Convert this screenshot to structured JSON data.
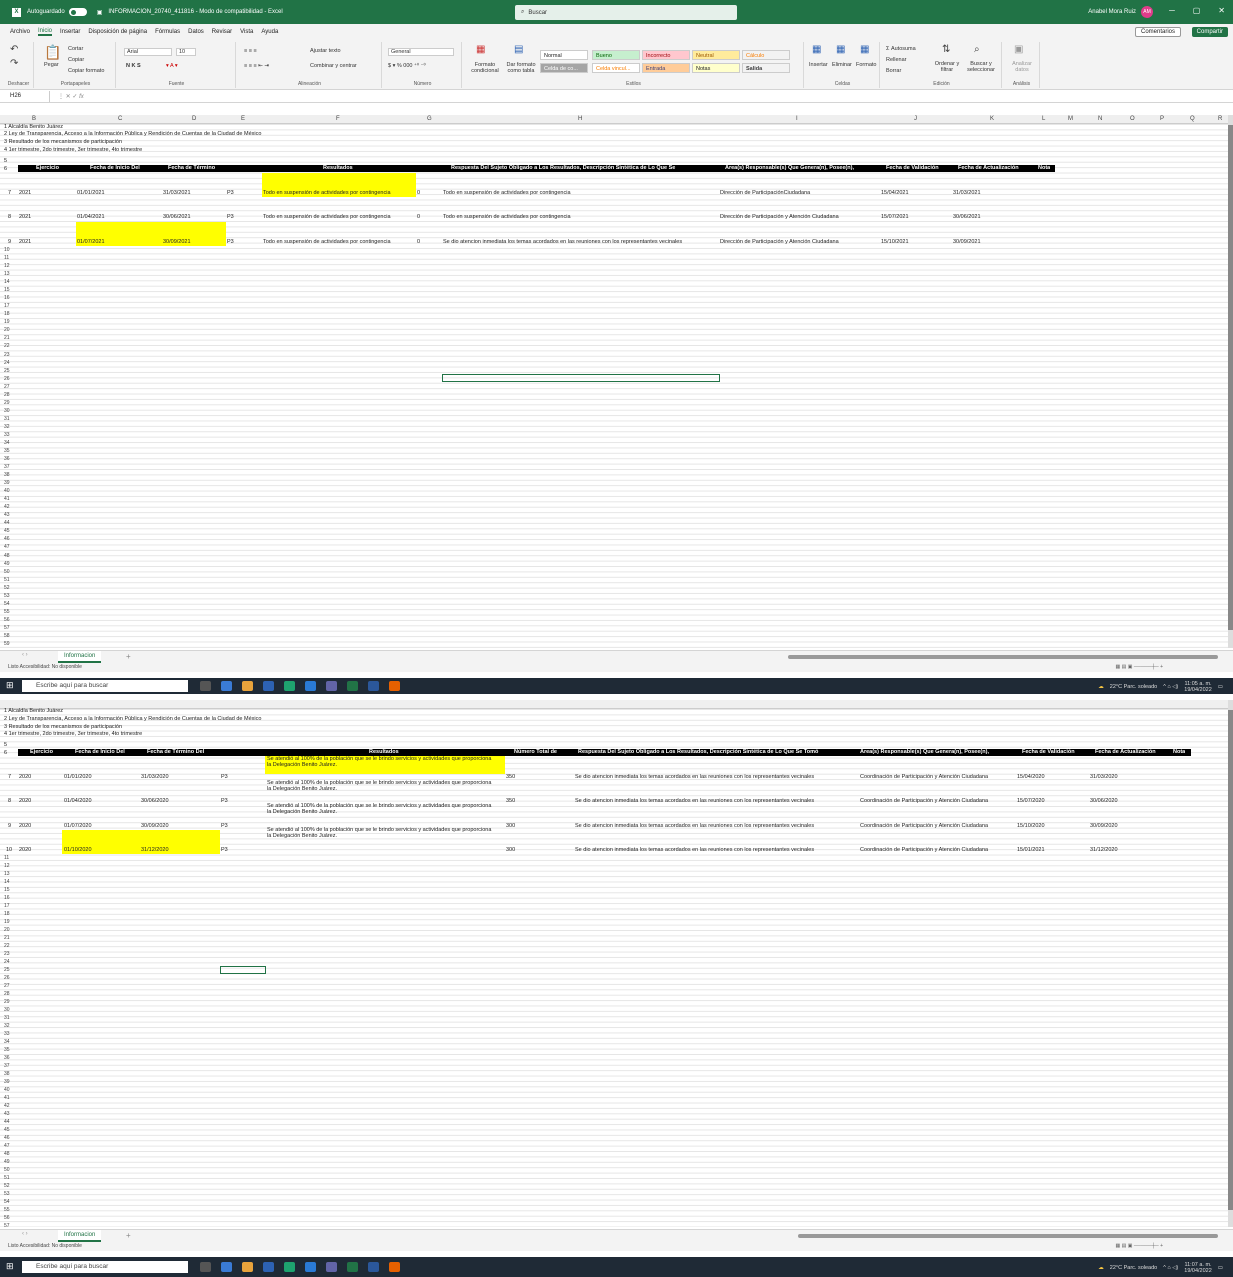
{
  "app": {
    "autosave_label": "Autoguardado",
    "file_title": "INFORMACION_20740_411816  -  Modo de compatibilidad  -  Excel",
    "search_placeholder": "Buscar",
    "user_name": "Anabel Mora Ruiz",
    "user_initials": "AM",
    "menu": [
      "Archivo",
      "Inicio",
      "Insertar",
      "Disposición de página",
      "Fórmulas",
      "Datos",
      "Revisar",
      "Vista",
      "Ayuda"
    ],
    "comments_label": "Comentarios",
    "share_label": "Compartir"
  },
  "ribbon": {
    "undo_group": "Deshacer",
    "clipboard": {
      "paste": "Pegar",
      "cut": "Cortar",
      "copy": "Copiar",
      "format_painter": "Copiar formato",
      "label": "Portapapeles"
    },
    "font": {
      "name": "Arial",
      "size": "10",
      "label": "Fuente"
    },
    "alignment": {
      "wrap": "Ajustar texto",
      "merge": "Combinar y centrar",
      "label": "Alineación"
    },
    "number": {
      "format": "General",
      "label": "Número"
    },
    "styles": {
      "cond_format": "Formato condicional",
      "table_format": "Dar formato como tabla",
      "cells": [
        "Normal",
        "Bueno",
        "Incorrecto",
        "Neutral",
        "Cálculo",
        "Celda de co...",
        "Celda vincul...",
        "Entrada",
        "Notas",
        "Salida"
      ],
      "label": "Estilos"
    },
    "cells": {
      "insert": "Insertar",
      "delete": "Eliminar",
      "format": "Formato",
      "label": "Celdas"
    },
    "editing": {
      "autosum": "Autosuma",
      "fill": "Rellenar",
      "clear": "Borrar",
      "sort": "Ordenar y filtrar",
      "find": "Buscar y seleccionar",
      "label": "Edición"
    },
    "analysis": {
      "analyze": "Analizar datos",
      "label": "Análisis"
    }
  },
  "top": {
    "name_box": "H26",
    "columns": [
      "B",
      "C",
      "D",
      "E",
      "F",
      "G",
      "H",
      "I",
      "J",
      "K",
      "L",
      "M",
      "N",
      "O",
      "P",
      "Q",
      "R"
    ],
    "header_info": [
      "1  Alcaldía Benito Juárez",
      "2  Ley de Transparencia, Acceso a la Información Pública y Rendición de Cuentas de la Ciudad de México",
      "3  Resultado de los mecanismos de participación",
      "4  1er trimestre, 2do trimestre, 3er trimestre, 4to trimestre"
    ],
    "table_headers": [
      "Ejercicio",
      "Fecha de Inicio Del",
      "Fecha de Término",
      "Resultados",
      "Respuesta Del Sujeto Obligado a Los Resultados, Descripción Sintética de Lo Que Se",
      "Área(s) Responsable(s) Que Genera(n), Posee(n),",
      "Fecha de Validación",
      "Fecha de Actualización",
      "Nota"
    ],
    "rows": [
      {
        "n": "7",
        "ej": "2021",
        "ini": "01/01/2021",
        "fin": "31/03/2021",
        "e": "P3",
        "res": "Todo en suspensión de actividades por contingencia",
        "g": "0",
        "resp": "Todo en suspensión de actividades por contingencia",
        "area": "Dirección de ParticipaciónCiudadana",
        "val": "15/04/2021",
        "act": "31/03/2021"
      },
      {
        "n": "8",
        "ej": "2021",
        "ini": "01/04/2021",
        "fin": "30/06/2021",
        "e": "P3",
        "res": "Todo en suspensión de actividades por contingencia",
        "g": "0",
        "resp": "Todo en suspensión de actividades por contingencia",
        "area": "Dirección de Participación y Atención Ciudadana",
        "val": "15/07/2021",
        "act": "30/06/2021"
      },
      {
        "n": "9",
        "ej": "2021",
        "ini": "01/07/2021",
        "fin": "30/09/2021",
        "e": "P3",
        "res": "Todo en suspensión de actividades por contingencia",
        "g": "0",
        "resp": "Se dio atencion inmediata los temas acordados en las reuniones con los representantes vecinales",
        "area": "Dirección de Participación y Atención Ciudadana",
        "val": "15/10/2021",
        "act": "30/09/2021"
      }
    ],
    "sheet_tab": "Informacion",
    "status": "Listo    Accesibilidad: No disponible"
  },
  "bottom": {
    "header_info": [
      "1  Alcaldía Benito Juárez",
      "2  Ley de Transparencia, Acceso a la Información Pública y Rendición de Cuentas de la Ciudad de México",
      "3  Resultado de los mecanismos de participación",
      "4  1er trimestre, 2do trimestre, 3er trimestre, 4to trimestre"
    ],
    "table_headers": [
      "Ejercicio",
      "Fecha de Inicio Del",
      "Fecha de Término Del",
      "Resultados",
      "Número Total de",
      "Respuesta Del Sujeto Obligado a Los Resultados, Descripción Sintética de Lo Que Se Tomó",
      "Área(s) Responsable(s) Que Genera(n), Posee(n),",
      "Fecha de Validación",
      "Fecha de Actualización",
      "Nota"
    ],
    "result_text": "Se atendió al 100% de la población que se le brindo servicios y actividades que proporciona la Delegación Benito Juárez.",
    "rows": [
      {
        "n": "7",
        "ej": "2020",
        "ini": "01/01/2020",
        "fin": "31/03/2020",
        "e": "P3",
        "num": "350",
        "resp": "Se dio atencion inmediata los temas acordados en las reuniones con los representantes vecinales",
        "area": "Coordinación de Participación y Atención Ciudadana",
        "val": "15/04/2020",
        "act": "31/03/2020"
      },
      {
        "n": "8",
        "ej": "2020",
        "ini": "01/04/2020",
        "fin": "30/06/2020",
        "e": "P3",
        "num": "350",
        "resp": "Se dio atencion inmediata los temas acordados en las reuniones con los representantes vecinales",
        "area": "Coordinación de Participación y Atención Ciudadana",
        "val": "15/07/2020",
        "act": "30/06/2020"
      },
      {
        "n": "9",
        "ej": "2020",
        "ini": "01/07/2020",
        "fin": "30/09/2020",
        "e": "P3",
        "num": "300",
        "resp": "Se dio atencion inmediata los temas acordados en las reuniones con los representantes vecinales",
        "area": "Coordinación de Participación y Atención Ciudadana",
        "val": "15/10/2020",
        "act": "30/09/2020"
      },
      {
        "n": "10",
        "ej": "2020",
        "ini": "01/10/2020",
        "fin": "31/12/2020",
        "e": "P3",
        "num": "300",
        "resp": "Se dio atencion inmediata los temas acordados en las reuniones con los representantes vecinales",
        "area": "Coordinación de Participación y Atención Ciudadana",
        "val": "15/01/2021",
        "act": "31/12/2020"
      }
    ],
    "sheet_tab": "Informacion",
    "status": "Listo    Accesibilidad: No disponible"
  },
  "taskbar": {
    "search_placeholder": "Escribe aquí para buscar",
    "weather": "22°C  Parc. soleado",
    "time_top": "11:05 a. m.",
    "time_bottom": "11:07 a. m.",
    "date": "19/04/2022"
  },
  "colors": {
    "accent": "#217346",
    "highlight": "#ffff00",
    "header_fill": "#000000"
  }
}
